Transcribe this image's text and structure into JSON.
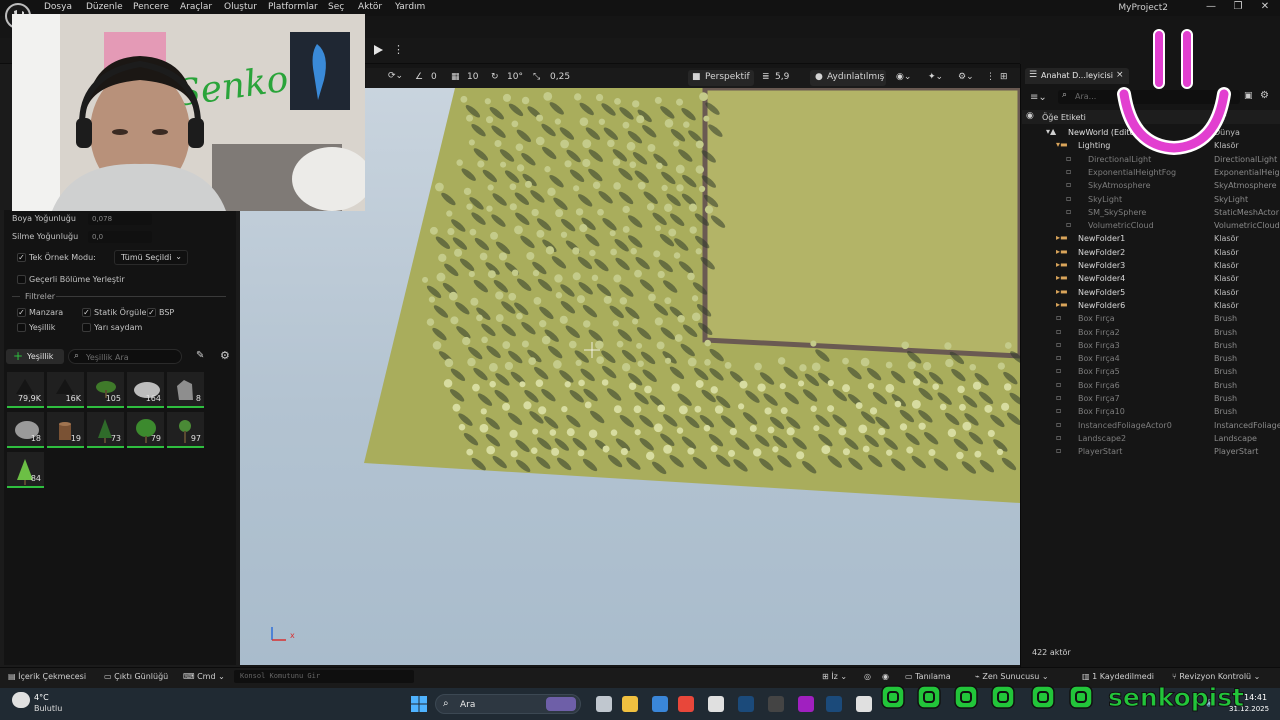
{
  "menu": [
    "Dosya",
    "Düzenle",
    "Pencere",
    "Araçlar",
    "Oluştur",
    "Platformlar",
    "Seç",
    "Aktör",
    "Yardım"
  ],
  "app_title": "MyProject2",
  "window_controls": {
    "minimize": "—",
    "maximize": "❐",
    "close": "✕"
  },
  "viewport_toolbar": {
    "snap_angle": "0",
    "grid_count": "10",
    "rot_snap": "10°",
    "scale_snap": "0,25",
    "perspective": "Perspektif",
    "camera_speed": "5,9",
    "lit_mode": "Aydınlatılmış"
  },
  "foliage_panel": {
    "paint_density_label": "Boya Yoğunluğu",
    "paint_density_value": "0,078",
    "erase_density_label": "Silme Yoğunluğu",
    "erase_density_value": "0,0",
    "single_instance_label": "Tek Örnek Modu:",
    "single_instance_value": "Tümü Seçildi",
    "place_in_level_label": "Geçerli Bölüme Yerleştir",
    "filters_label": "Filtreler",
    "filters": [
      {
        "label": "Manzara",
        "checked": true
      },
      {
        "label": "Statik Örgüler",
        "checked": true
      },
      {
        "label": "BSP",
        "checked": true
      },
      {
        "label": "Yeşillik",
        "checked": false
      },
      {
        "label": "Yarı saydam",
        "checked": false
      }
    ],
    "add_button": "Yeşillik",
    "search_placeholder": "Yeşillik Ara",
    "items": [
      {
        "count": "79,9K",
        "kind": "dark-tree"
      },
      {
        "count": "16K",
        "kind": "dark-tree"
      },
      {
        "count": "105",
        "kind": "bush"
      },
      {
        "count": "164",
        "kind": "rock-flat"
      },
      {
        "count": "8",
        "kind": "rock-tall"
      },
      {
        "count": "18",
        "kind": "rock"
      },
      {
        "count": "19",
        "kind": "stump"
      },
      {
        "count": "73",
        "kind": "pine"
      },
      {
        "count": "79",
        "kind": "round-tree"
      },
      {
        "count": "97",
        "kind": "small-tree"
      },
      {
        "count": "84",
        "kind": "pine-light"
      }
    ]
  },
  "outliner": {
    "tab_label": "Anahat D...leyicisi",
    "search_placeholder": "Ara...",
    "header_label": "Öğe Etiketi",
    "header_type": "Tür",
    "rows": [
      {
        "name": "NewWorld (Editor)",
        "type": "Dünya",
        "indent": 1,
        "kind": "world"
      },
      {
        "name": "Lighting",
        "type": "Klasör",
        "indent": 2,
        "kind": "folder-open"
      },
      {
        "name": "DirectionalLight",
        "type": "DirectionalLight",
        "indent": 3,
        "kind": "actor"
      },
      {
        "name": "ExponentialHeightFog",
        "type": "ExponentialHeightFog",
        "indent": 3,
        "kind": "actor"
      },
      {
        "name": "SkyAtmosphere",
        "type": "SkyAtmosphere",
        "indent": 3,
        "kind": "actor"
      },
      {
        "name": "SkyLight",
        "type": "SkyLight",
        "indent": 3,
        "kind": "actor"
      },
      {
        "name": "SM_SkySphere",
        "type": "StaticMeshActor",
        "indent": 3,
        "kind": "actor"
      },
      {
        "name": "VolumetricCloud",
        "type": "VolumetricCloud",
        "indent": 3,
        "kind": "actor"
      },
      {
        "name": "NewFolder1",
        "type": "Klasör",
        "indent": 2,
        "kind": "folder"
      },
      {
        "name": "NewFolder2",
        "type": "Klasör",
        "indent": 2,
        "kind": "folder"
      },
      {
        "name": "NewFolder3",
        "type": "Klasör",
        "indent": 2,
        "kind": "folder"
      },
      {
        "name": "NewFolder4",
        "type": "Klasör",
        "indent": 2,
        "kind": "folder"
      },
      {
        "name": "NewFolder5",
        "type": "Klasör",
        "indent": 2,
        "kind": "folder"
      },
      {
        "name": "NewFolder6",
        "type": "Klasör",
        "indent": 2,
        "kind": "folder"
      },
      {
        "name": "Box Fırça",
        "type": "Brush",
        "indent": 2,
        "kind": "actor"
      },
      {
        "name": "Box Fırça2",
        "type": "Brush",
        "indent": 2,
        "kind": "actor"
      },
      {
        "name": "Box Fırça3",
        "type": "Brush",
        "indent": 2,
        "kind": "actor"
      },
      {
        "name": "Box Fırça4",
        "type": "Brush",
        "indent": 2,
        "kind": "actor"
      },
      {
        "name": "Box Fırça5",
        "type": "Brush",
        "indent": 2,
        "kind": "actor"
      },
      {
        "name": "Box Fırça6",
        "type": "Brush",
        "indent": 2,
        "kind": "actor"
      },
      {
        "name": "Box Fırça7",
        "type": "Brush",
        "indent": 2,
        "kind": "actor"
      },
      {
        "name": "Box Fırça10",
        "type": "Brush",
        "indent": 2,
        "kind": "actor"
      },
      {
        "name": "InstancedFoliageActor0",
        "type": "InstancedFoliage",
        "indent": 2,
        "kind": "actor"
      },
      {
        "name": "Landscape2",
        "type": "Landscape",
        "indent": 2,
        "kind": "actor"
      },
      {
        "name": "PlayerStart",
        "type": "PlayerStart",
        "indent": 2,
        "kind": "actor"
      }
    ],
    "actor_count": "422 aktör"
  },
  "statusbar": {
    "content_drawer": "İçerik Çekmecesi",
    "output_log": "Çıktı Günlüğü",
    "cmd": "Cmd",
    "console_placeholder": "Konsol Komutunu Gir",
    "trace": "İz",
    "diagnostics": "Tanılama",
    "zen_server": "Zen Sunucusu",
    "saved": "1 Kaydedilmedi",
    "revision": "Revizyon Kontrolü"
  },
  "taskbar": {
    "weather_temp": "4°C",
    "weather_desc": "Bulutlu",
    "search": "Ara",
    "time": "14:41",
    "date": "31.12.2025"
  },
  "overlay": {
    "webcam_sign": "Senko",
    "social_handle": "senkopist"
  },
  "colors": {
    "accent_green": "#2fbf3f",
    "social_green": "#22c53a",
    "smile_pink": "#e23fd0",
    "grass": "#a9ad5c"
  }
}
